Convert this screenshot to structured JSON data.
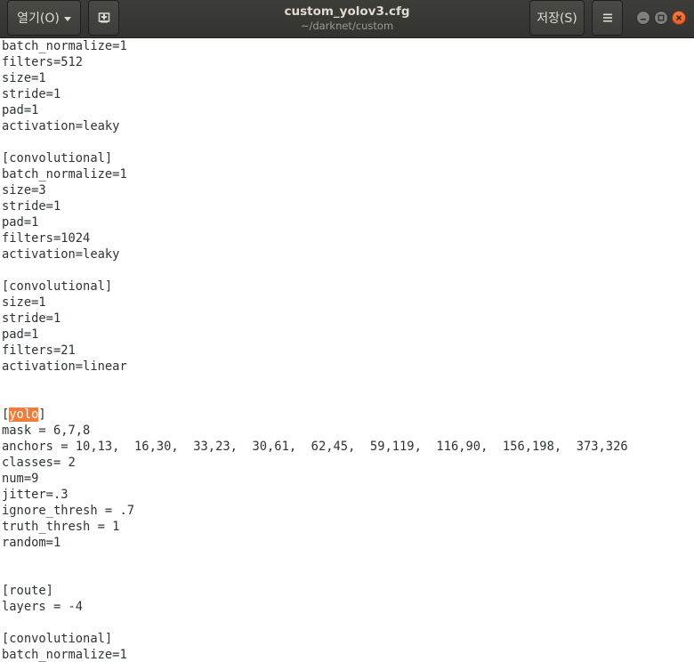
{
  "window": {
    "title": "custom_yolov3.cfg",
    "path": "~/darknet/custom"
  },
  "toolbar": {
    "open_label": "열기(O)",
    "new_doc_icon": "new-document-icon",
    "save_label": "저장(S)",
    "menu_icon": "hamburger-menu-icon"
  },
  "window_controls": {
    "minimize_icon": "minimize-icon",
    "maximize_icon": "maximize-icon",
    "close_icon": "close-icon",
    "close_color": "#e95420"
  },
  "editor": {
    "search_highlight": "yolo",
    "highlight_color": "#f07c3a",
    "lines": [
      "batch_normalize=1",
      "filters=512",
      "size=1",
      "stride=1",
      "pad=1",
      "activation=leaky",
      "",
      "[convolutional]",
      "batch_normalize=1",
      "size=3",
      "stride=1",
      "pad=1",
      "filters=1024",
      "activation=leaky",
      "",
      "[convolutional]",
      "size=1",
      "stride=1",
      "pad=1",
      "filters=21",
      "activation=linear",
      "",
      "",
      "[yolo]",
      "mask = 6,7,8",
      "anchors = 10,13,  16,30,  33,23,  30,61,  62,45,  59,119,  116,90,  156,198,  373,326",
      "classes= 2",
      "num=9",
      "jitter=.3",
      "ignore_thresh = .7",
      "truth_thresh = 1",
      "random=1",
      "",
      "",
      "[route]",
      "layers = -4",
      "",
      "[convolutional]",
      "batch_normalize=1"
    ]
  }
}
